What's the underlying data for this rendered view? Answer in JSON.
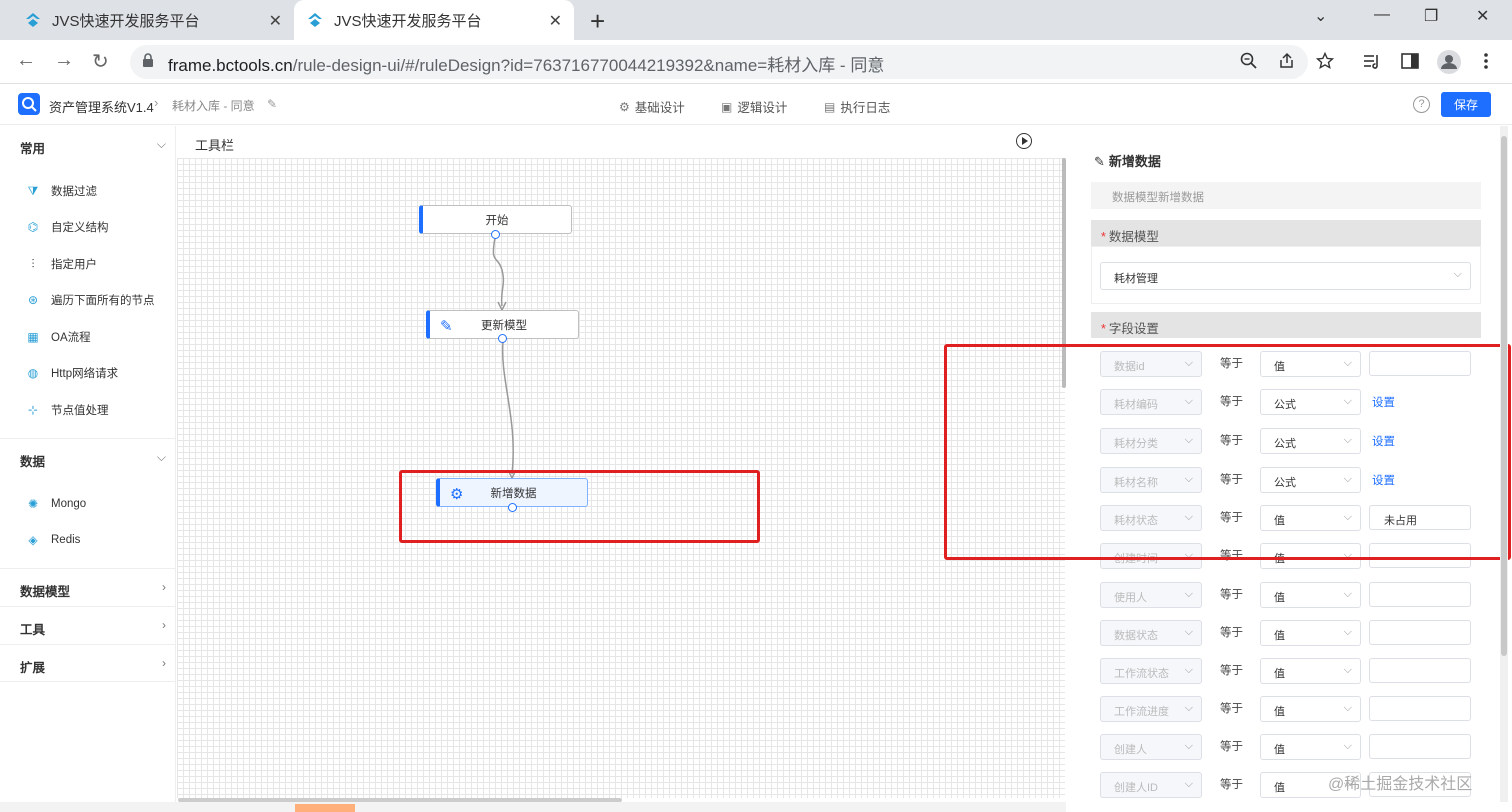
{
  "browser": {
    "tabs": [
      {
        "title": "JVS快速开发服务平台"
      },
      {
        "title": "JVS快速开发服务平台"
      }
    ],
    "url_host": "frame.bctools.cn",
    "url_path": "/rule-design-ui/#/ruleDesign?id=763716770044219392&name=耗材入库 - 同意",
    "icons": [
      "back-icon",
      "forward-icon",
      "reload-icon",
      "lock-icon",
      "zoom-icon",
      "share-icon",
      "star-icon",
      "media-icon",
      "sidepanel-icon",
      "profile-icon",
      "menu-icon"
    ]
  },
  "header": {
    "app_name": "资产管理系统V1.4",
    "crumb": "耗材入库 - 同意",
    "nav": [
      {
        "label": "基础设计",
        "icon": "gear-icon"
      },
      {
        "label": "逻辑设计",
        "icon": "logic-icon"
      },
      {
        "label": "执行日志",
        "icon": "doc-icon"
      }
    ],
    "help": "?",
    "save_label": "保存"
  },
  "sidebar": {
    "sections": [
      {
        "title": "常用",
        "expanded": true,
        "items": [
          {
            "label": "数据过滤",
            "icon": "filter-icon"
          },
          {
            "label": "自定义结构",
            "icon": "structure-icon"
          },
          {
            "label": "指定用户",
            "icon": "sliders-icon"
          },
          {
            "label": "遍历下面所有的节点",
            "icon": "traverse-icon"
          },
          {
            "label": "OA流程",
            "icon": "flow-icon"
          },
          {
            "label": "Http网络请求",
            "icon": "globe-icon"
          },
          {
            "label": "节点值处理",
            "icon": "node-icon"
          }
        ]
      },
      {
        "title": "数据",
        "expanded": true,
        "items": [
          {
            "label": "Mongo",
            "icon": "mongo-icon"
          },
          {
            "label": "Redis",
            "icon": "redis-icon"
          }
        ]
      },
      {
        "title": "数据模型",
        "expanded": false
      },
      {
        "title": "工具",
        "expanded": false
      },
      {
        "title": "扩展",
        "expanded": false
      }
    ]
  },
  "canvas": {
    "toolbar_label": "工具栏",
    "nodes": [
      {
        "label": "开始"
      },
      {
        "label": "更新模型",
        "icon": "edit-icon"
      },
      {
        "label": "新增数据",
        "icon": "data-add-icon",
        "selected": true
      }
    ]
  },
  "panel": {
    "title": "新增数据",
    "description": "数据模型新增数据",
    "model_section": "数据模型",
    "model_value": "耗材管理",
    "fields_section": "字段设置",
    "equals_label": "等于",
    "set_label": "设置",
    "rows": [
      {
        "field": "数据id",
        "type": "值",
        "value": ""
      },
      {
        "field": "耗材编码",
        "type": "公式",
        "value": "设置"
      },
      {
        "field": "耗材分类",
        "type": "公式",
        "value": "设置"
      },
      {
        "field": "耗材名称",
        "type": "公式",
        "value": "设置"
      },
      {
        "field": "耗材状态",
        "type": "值",
        "value": "未占用"
      },
      {
        "field": "创建时间",
        "type": "值",
        "value": ""
      },
      {
        "field": "使用人",
        "type": "值",
        "value": ""
      },
      {
        "field": "数据状态",
        "type": "值",
        "value": ""
      },
      {
        "field": "工作流状态",
        "type": "值",
        "value": ""
      },
      {
        "field": "工作流进度",
        "type": "值",
        "value": ""
      },
      {
        "field": "创建人",
        "type": "值",
        "value": ""
      },
      {
        "field": "创建人ID",
        "type": "值",
        "value": ""
      }
    ]
  },
  "watermark": "@稀土掘金技术社区",
  "colors": {
    "accent": "#1e6fff",
    "highlight": "#e02020",
    "icon": "#2a9fd6"
  }
}
